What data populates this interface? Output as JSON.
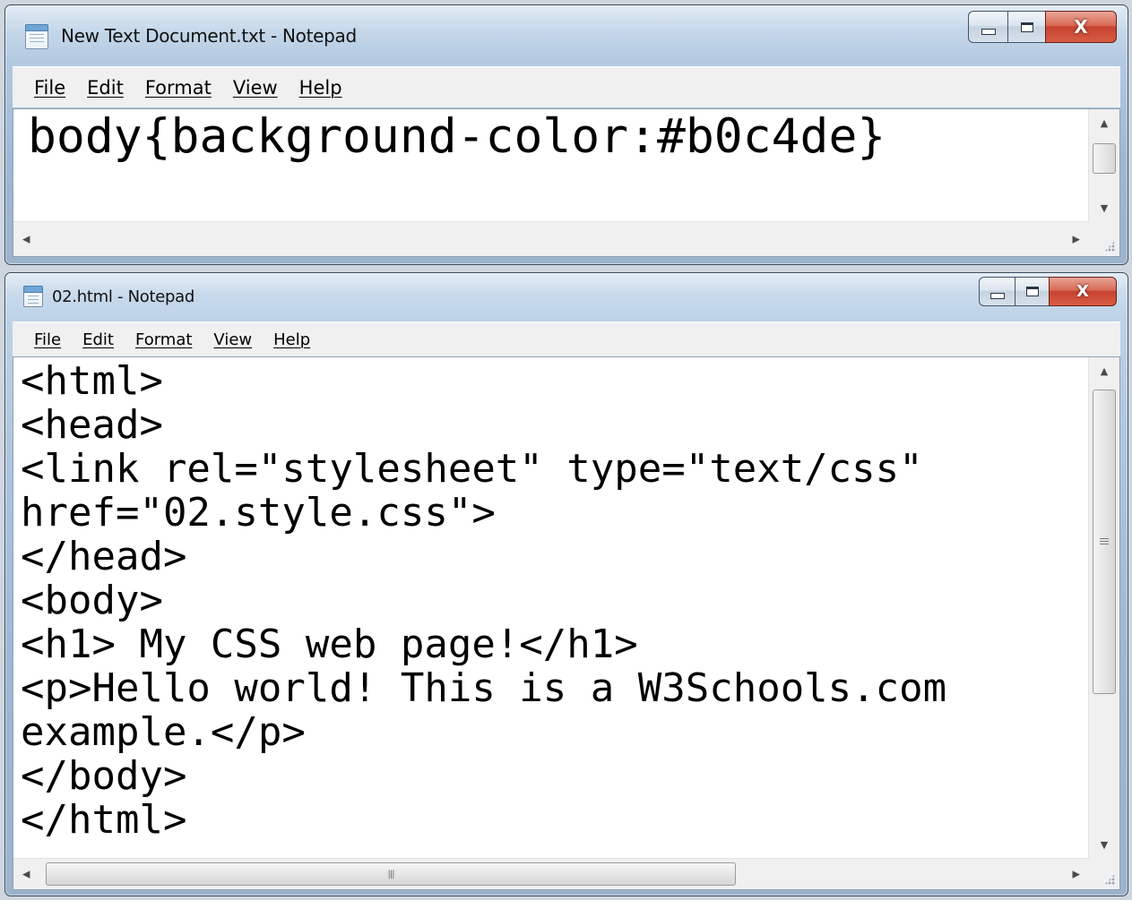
{
  "windows": [
    {
      "title": "New Text Document.txt - Notepad",
      "menu": [
        "File",
        "Edit",
        "Format",
        "View",
        "Help"
      ],
      "content": "body{background-color:#b0c4de}",
      "close_glyph": "X"
    },
    {
      "title": "02.html - Notepad",
      "menu": [
        "File",
        "Edit",
        "Format",
        "View",
        "Help"
      ],
      "content": "<html>\n<head>\n<link rel=\"stylesheet\" type=\"text/css\"\nhref=\"02.style.css\">\n</head>\n<body>\n<h1> My CSS web page!</h1>\n<p>Hello world! This is a W3Schools.com\nexample.</p>\n</body>\n</html>",
      "close_glyph": "X"
    }
  ],
  "icons": {
    "app": "notepad-icon",
    "minimize": "minimize-icon",
    "maximize": "maximize-icon",
    "close": "close-icon",
    "scroll_up": "scroll-up-arrow-icon",
    "scroll_down": "scroll-down-arrow-icon",
    "scroll_left": "scroll-left-arrow-icon",
    "scroll_right": "scroll-right-arrow-icon"
  },
  "colors": {
    "close_button": "#c74330",
    "frame": "#aec5de",
    "editor_background": "#ffffff",
    "menubar_background": "#f0f0f0"
  }
}
